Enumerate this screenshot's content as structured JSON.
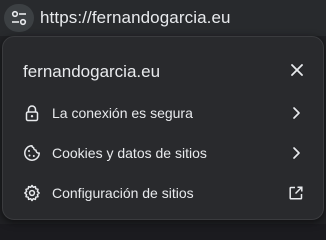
{
  "address_bar": {
    "url": "https://fernandogarcia.eu",
    "site_info_icon": "tune-icon"
  },
  "site_info_panel": {
    "title": "fernandogarcia.eu",
    "close_icon": "close-icon",
    "items": [
      {
        "label": "La conexión es segura",
        "icon": "lock-icon",
        "trailing_icon": "chevron-right-icon"
      },
      {
        "label": "Cookies y datos de sitios",
        "icon": "cookie-icon",
        "trailing_icon": "chevron-right-icon"
      },
      {
        "label": "Configuración de sitios",
        "icon": "gear-icon",
        "trailing_icon": "open-in-new-icon"
      }
    ]
  },
  "colors": {
    "panel_background": "#292a2d",
    "text": "#e8eaed",
    "address_bar_background": "#282a2d"
  }
}
